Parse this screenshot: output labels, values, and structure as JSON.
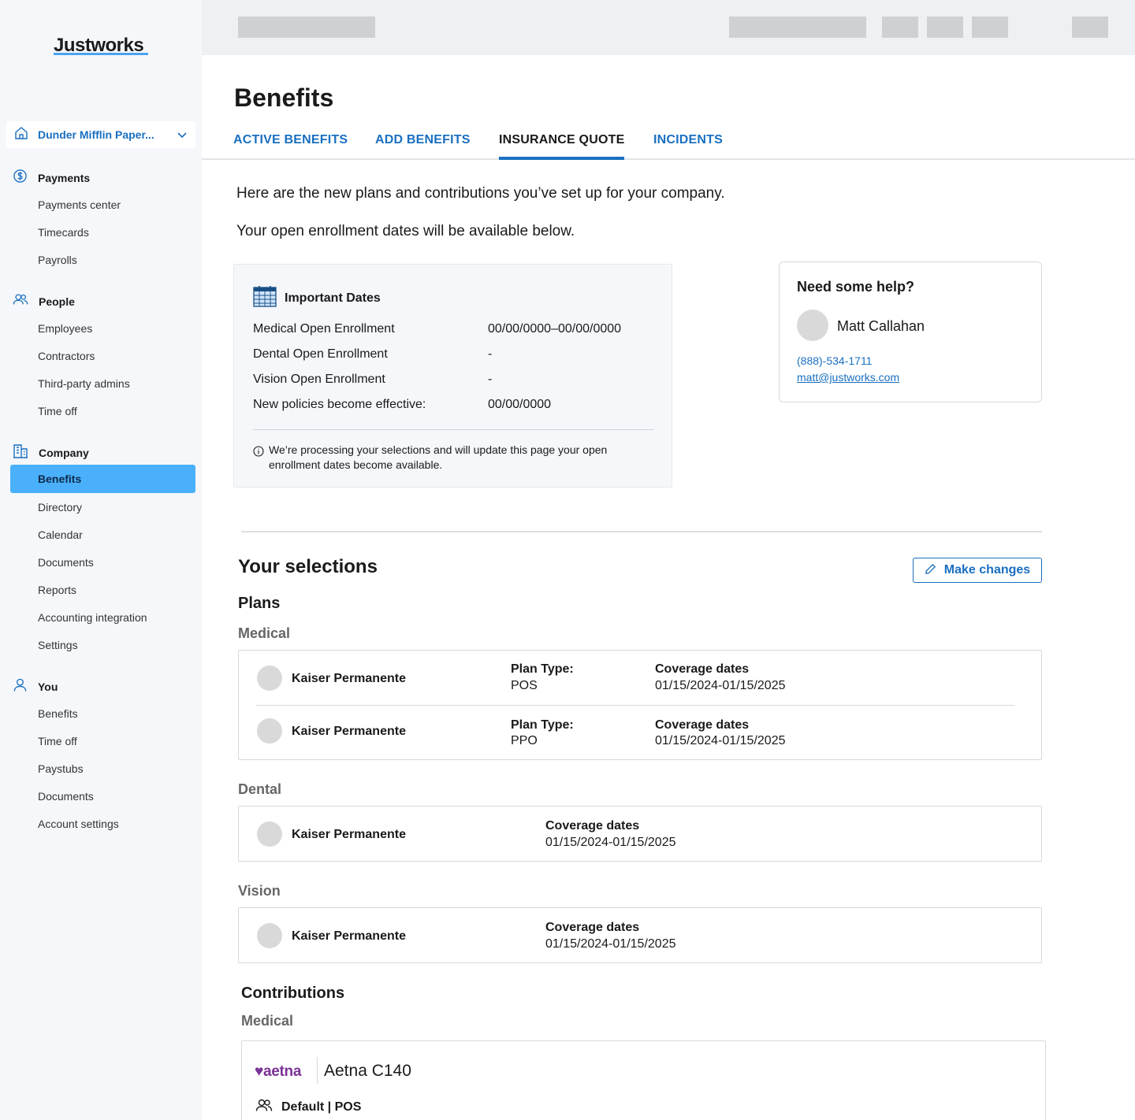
{
  "brand": {
    "logo": "Justworks"
  },
  "company_selector": {
    "label": "Dunder Mifflin Paper..."
  },
  "sidebar": {
    "sections": [
      {
        "label": "Payments",
        "items": [
          "Payments center",
          "Timecards",
          "Payrolls"
        ]
      },
      {
        "label": "People",
        "items": [
          "Employees",
          "Contractors",
          "Third-party admins",
          "Time off"
        ]
      },
      {
        "label": "Company",
        "items": [
          "Benefits",
          "Directory",
          "Calendar",
          "Documents",
          "Reports",
          "Accounting integration",
          "Settings"
        ]
      },
      {
        "label": "You",
        "items": [
          "Benefits",
          "Time off",
          "Paystubs",
          "Documents",
          "Account settings"
        ]
      }
    ],
    "active_item": "Company / Benefits"
  },
  "page": {
    "title": "Benefits",
    "tabs": [
      "ACTIVE BENEFITS",
      "ADD BENEFITS",
      "INSURANCE QUOTE",
      "INCIDENTS"
    ],
    "active_tab": "INSURANCE QUOTE",
    "intro_1": "Here are the new plans and contributions you’ve set up for your company.",
    "intro_2": "Your open enrollment dates will be available below."
  },
  "important_dates": {
    "title": "Important Dates",
    "rows": [
      {
        "label": "Medical Open Enrollment",
        "value": "00/00/0000–00/00/0000"
      },
      {
        "label": "Dental Open Enrollment",
        "value": "-"
      },
      {
        "label": "Vision Open Enrollment",
        "value": "-"
      },
      {
        "label": "New policies become effective:",
        "value": "00/00/0000"
      }
    ],
    "note": "We’re processing your selections and will update this page your open enrollment dates become available."
  },
  "help": {
    "title": "Need some help?",
    "name": "Matt Callahan",
    "phone": "(888)-534-1711",
    "email": "matt@justworks.com"
  },
  "selections": {
    "title": "Your selections",
    "make_changes": "Make changes",
    "plans_title": "Plans",
    "medical_label": "Medical",
    "medical": [
      {
        "name": "Kaiser Permanente",
        "plan_type_label": "Plan Type:",
        "plan_type": "POS",
        "coverage_label": "Coverage dates",
        "coverage": "01/15/2024-01/15/2025"
      },
      {
        "name": "Kaiser Permanente",
        "plan_type_label": "Plan Type:",
        "plan_type": "PPO",
        "coverage_label": "Coverage dates",
        "coverage": "01/15/2024-01/15/2025"
      }
    ],
    "dental_label": "Dental",
    "dental": [
      {
        "name": "Kaiser Permanente",
        "coverage_label": "Coverage dates",
        "coverage": "01/15/2024-01/15/2025"
      }
    ],
    "vision_label": "Vision",
    "vision": [
      {
        "name": "Kaiser Permanente",
        "coverage_label": "Coverage dates",
        "coverage": "01/15/2024-01/15/2025"
      }
    ],
    "contributions_title": "Contributions",
    "contrib_medical_label": "Medical",
    "contrib_plan": {
      "logo_text": "aetna",
      "name": "Aetna C140",
      "tier": "Default | POS"
    }
  },
  "colors": {
    "accent": "#1a6fc0",
    "active_nav": "#4ab0fb",
    "sidebar_bg": "#f5f7fb",
    "aetna": "#7a3296"
  }
}
